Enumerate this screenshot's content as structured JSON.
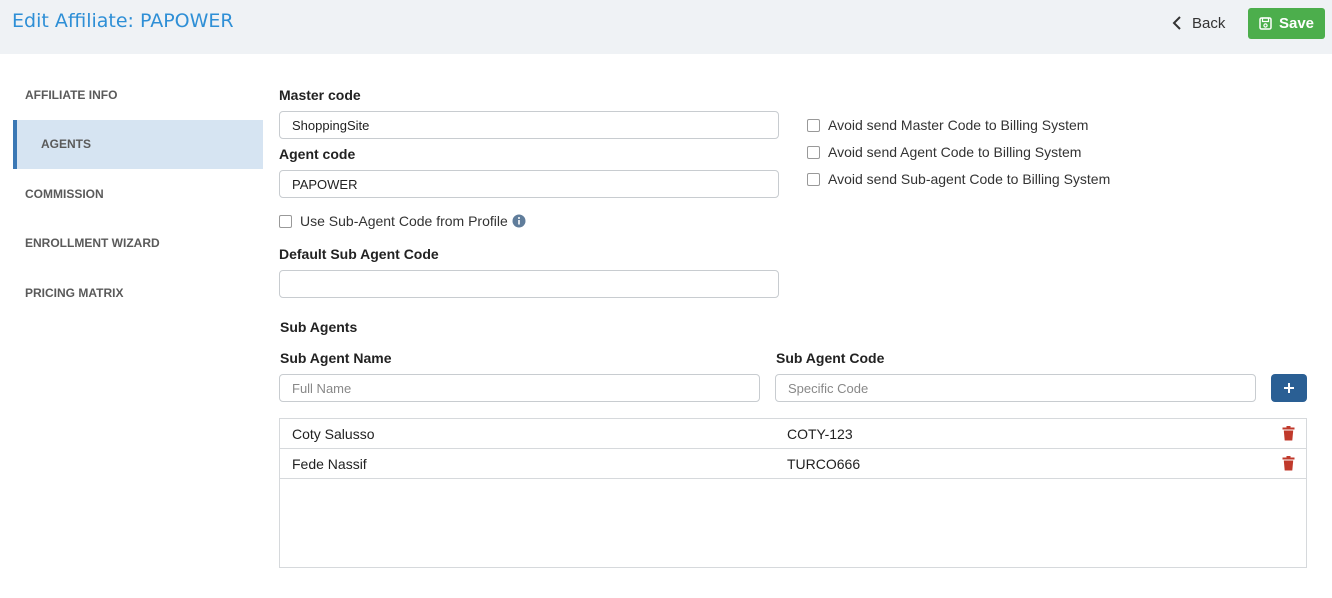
{
  "header": {
    "title": "Edit Affiliate: PAPOWER",
    "back_label": "Back",
    "save_label": "Save"
  },
  "sidebar": {
    "items": [
      {
        "label": "AFFILIATE INFO",
        "active": false
      },
      {
        "label": "AGENTS",
        "active": true
      },
      {
        "label": "COMMISSION",
        "active": false
      },
      {
        "label": "ENROLLMENT WIZARD",
        "active": false
      },
      {
        "label": "PRICING MATRIX",
        "active": false
      }
    ]
  },
  "form": {
    "master_code_label": "Master code",
    "master_code_value": "ShoppingSite",
    "agent_code_label": "Agent code",
    "agent_code_value": "PAPOWER",
    "use_subagent_label": "Use Sub-Agent Code from Profile",
    "default_sub_agent_label": "Default Sub Agent Code",
    "default_sub_agent_value": "",
    "avoid_master_label": "Avoid send Master Code to Billing System",
    "avoid_agent_label": "Avoid send Agent Code to Billing System",
    "avoid_subagent_label": "Avoid send Sub-agent Code to Billing System"
  },
  "sub_agents": {
    "section_title": "Sub Agents",
    "name_header": "Sub Agent Name",
    "code_header": "Sub Agent Code",
    "name_placeholder": "Full Name",
    "code_placeholder": "Specific Code",
    "rows": [
      {
        "name": "Coty Salusso",
        "code": "COTY-123"
      },
      {
        "name": "Fede Nassif",
        "code": "TURCO666"
      }
    ]
  },
  "colors": {
    "title": "#2e8fd6",
    "save": "#4cae4c",
    "add": "#2a5f94",
    "trash": "#c0392b",
    "active_nav": "#d6e4f2"
  }
}
